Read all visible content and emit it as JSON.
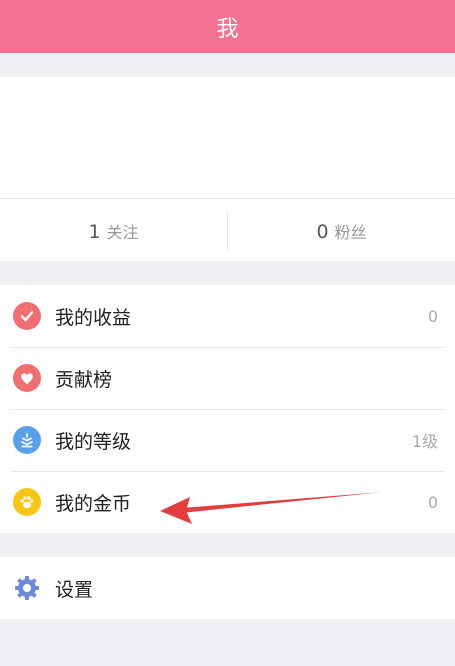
{
  "header": {
    "title": "我"
  },
  "stats": {
    "following": {
      "count": "1",
      "label": "关注"
    },
    "followers": {
      "count": "0",
      "label": "粉丝"
    }
  },
  "menu": {
    "earnings": {
      "label": "我的收益",
      "value": "0",
      "icon": "check-circle-icon",
      "color": "#ef6f73"
    },
    "ranking": {
      "label": "贡献榜",
      "icon": "heart-icon",
      "color": "#ef6f73"
    },
    "level": {
      "label": "我的等级",
      "value": "1级",
      "icon": "level-stack-icon",
      "color": "#5aa0e8"
    },
    "coins": {
      "label": "我的金币",
      "value": "0",
      "icon": "paw-coin-icon",
      "color": "#f5c518"
    },
    "settings": {
      "label": "设置",
      "icon": "gear-icon",
      "color": "#6e8bd6"
    }
  },
  "colors": {
    "header": "#f47292",
    "annotation_arrow": "#e43d3d"
  }
}
